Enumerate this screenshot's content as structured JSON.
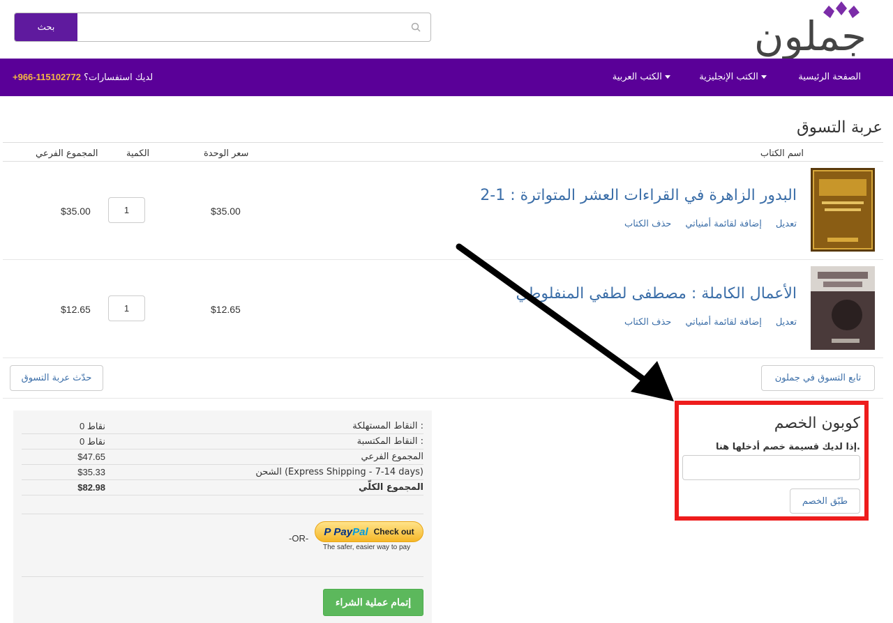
{
  "header": {
    "logo_text": "جملون",
    "search": {
      "button_label": "بحث",
      "placeholder": "",
      "value": ""
    }
  },
  "nav": {
    "items": [
      {
        "label": "الصفحة الرئيسية",
        "has_dropdown": false
      },
      {
        "label": "الكتب الإنجليزية",
        "has_dropdown": true
      },
      {
        "label": "الكتب العربية",
        "has_dropdown": true
      }
    ],
    "contact_label": "لديك استفسارات؟",
    "contact_phone": "+966-115102772",
    "background": "#5a0098",
    "accent": "#f4b942"
  },
  "cart": {
    "title": "عربة التسوق",
    "columns": {
      "book_name": "اسم الكتاب",
      "unit_price": "سعر الوحدة",
      "quantity": "الكمية",
      "subtotal": "المجموع الفرعي"
    },
    "items": [
      {
        "title": "البدور الزاهرة في القراءات العشر المتواترة : 1-2",
        "links": [
          "تعديل",
          "إضافة لقائمة أمنياتي",
          "حذف الكتاب"
        ],
        "unit_price": "$35.00",
        "quantity": "1",
        "subtotal": "$35.00",
        "cover_color": "#6b4a12"
      },
      {
        "title": "الأعمال الكاملة : مصطفى لطفي المنفلوطي",
        "links": [
          "تعديل",
          "إضافة لقائمة أمنياتي",
          "حذف الكتاب"
        ],
        "unit_price": "$12.65",
        "quantity": "1",
        "subtotal": "$12.65",
        "cover_color": "#3a3030"
      }
    ],
    "continue_button": "تابع التسوق في جملون",
    "update_button": "حدّث عربة التسوق"
  },
  "summary": {
    "rows": [
      {
        "label": "النقاط المستهلكة :",
        "value": "0 نقاط",
        "bold": false
      },
      {
        "label": "النقاط المكتسبة :",
        "value": "0 نقاط",
        "bold": false
      },
      {
        "label": "المجموع الفرعي",
        "value": "$47.65",
        "bold": false
      },
      {
        "label": "الشحن (Express Shipping - 7-14 days)",
        "value": "$35.33",
        "bold": false
      },
      {
        "label": "المجموع الكلّي",
        "value": "$82.98",
        "bold": true
      }
    ],
    "or_text": "-OR-",
    "paypal": {
      "p": "P",
      "pay": "Pay",
      "pal": "Pal",
      "checkout": "Check out",
      "tagline": "The safer, easier way to pay"
    },
    "checkout_button": "إتمام عملية الشراء"
  },
  "coupon": {
    "title": "كوبون الخصم",
    "description": "إذا لديك قسيمة خصم أدخلها هنا.",
    "input_value": "",
    "apply_button": "طبّق الخصم",
    "highlight_color": "#ee1c1c"
  }
}
